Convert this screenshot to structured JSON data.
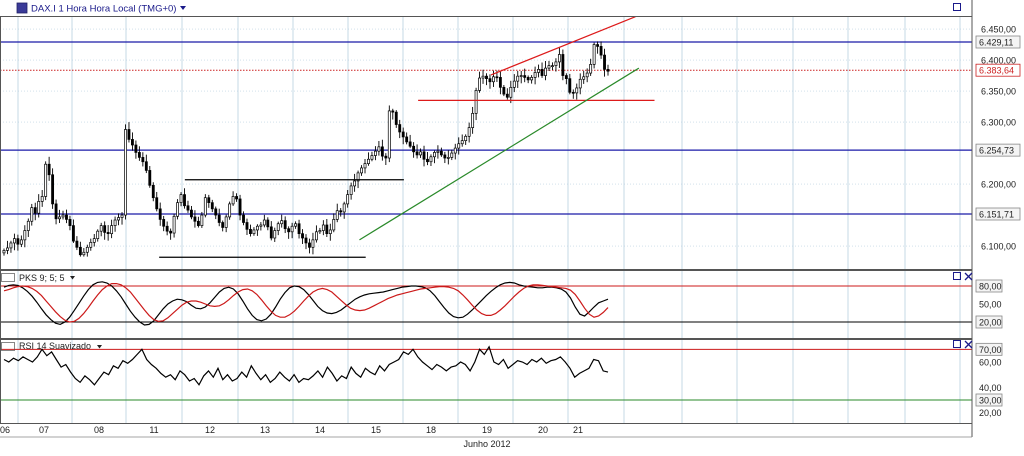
{
  "header": {
    "title": "DAX.I 1 Hora Hora Local (TMG+0)",
    "dropdown_icon": "triangle-down-icon",
    "window_icon": "square-icon"
  },
  "colors": {
    "grid": "#b8cfe0",
    "price_line": "#1a1aa8",
    "last_price": "#cc2222",
    "trend_red": "#dd1a1a",
    "trend_green": "#2a8a2a",
    "black": "#000000",
    "osc_signal": "#cc1a1a"
  },
  "chart_data": [
    {
      "type": "candlestick",
      "title": "DAX.I 1 Hora Hora Local (TMG+0)",
      "y_ticks": [
        "6.450,00",
        "6.400,00",
        "6.350,00",
        "6.300,00",
        "6.200,00",
        "6.150,00",
        "6.100,00"
      ],
      "ylim": [
        6075,
        6465
      ],
      "x_ticks": [
        "06",
        "07",
        "08",
        "11",
        "12",
        "13",
        "14",
        "15",
        "18",
        "19",
        "20",
        "21"
      ],
      "xlabel": "Junho 2012",
      "price_labels": [
        {
          "label": "6.429,11",
          "value": 6429.11,
          "style": "level"
        },
        {
          "label": "6.383,64",
          "value": 6383.64,
          "style": "last"
        },
        {
          "label": "6.254,73",
          "value": 6254.73,
          "style": "level"
        },
        {
          "label": "6.151,71",
          "value": 6151.71,
          "style": "level"
        }
      ],
      "close": [
        6093,
        6097,
        6105,
        6112,
        6103,
        6110,
        6125,
        6140,
        6162,
        6153,
        6172,
        6180,
        6232,
        6215,
        6168,
        6144,
        6147,
        6150,
        6143,
        6133,
        6108,
        6098,
        6086,
        6090,
        6098,
        6106,
        6112,
        6124,
        6133,
        6122,
        6120,
        6133,
        6142,
        6146,
        6150,
        6288,
        6272,
        6263,
        6251,
        6243,
        6236,
        6222,
        6198,
        6178,
        6160,
        6143,
        6132,
        6124,
        6121,
        6148,
        6170,
        6183,
        6165,
        6158,
        6147,
        6140,
        6133,
        6150,
        6178,
        6170,
        6160,
        6150,
        6138,
        6130,
        6147,
        6168,
        6180,
        6176,
        6150,
        6138,
        6127,
        6120,
        6126,
        6132,
        6134,
        6142,
        6131,
        6113,
        6125,
        6136,
        6141,
        6128,
        6123,
        6132,
        6136,
        6120,
        6113,
        6105,
        6098,
        6110,
        6123,
        6125,
        6134,
        6120,
        6126,
        6143,
        6157,
        6155,
        6168,
        6183,
        6197,
        6205,
        6218,
        6226,
        6233,
        6240,
        6246,
        6253,
        6260,
        6245,
        6242,
        6318,
        6316,
        6296,
        6284,
        6276,
        6268,
        6261,
        6252,
        6247,
        6252,
        6240,
        6236,
        6244,
        6251,
        6253,
        6247,
        6242,
        6243,
        6250,
        6258,
        6265,
        6270,
        6277,
        6291,
        6314,
        6351,
        6371,
        6374,
        6370,
        6365,
        6373,
        6372,
        6356,
        6345,
        6340,
        6356,
        6366,
        6374,
        6375,
        6372,
        6368,
        6372,
        6380,
        6385,
        6375,
        6387,
        6391,
        6391,
        6397,
        6409,
        6375,
        6370,
        6348,
        6347,
        6355,
        6369,
        6373,
        6379,
        6393,
        6425,
        6422,
        6408,
        6385,
        6382
      ],
      "high": 6430,
      "low": 6083,
      "horizontal_levels": [
        6429.11,
        6254.73,
        6151.71
      ],
      "last_price": 6383.64,
      "trendlines": [
        {
          "color": "red",
          "x": [
            140.3,
            181.9
          ],
          "y": [
            6376,
            6470
          ]
        },
        {
          "color": "red",
          "x": [
            119.3,
            187.4
          ],
          "y": [
            6335,
            6335
          ]
        },
        {
          "color": "green",
          "x": [
            102.4,
            182.9
          ],
          "y": [
            6110,
            6387
          ]
        },
        {
          "color": "black",
          "x": [
            52.1,
            115.2
          ],
          "y": [
            6207,
            6207
          ]
        },
        {
          "color": "black",
          "x": [
            44.7,
            104.2
          ],
          "y": [
            6082,
            6082
          ]
        }
      ]
    },
    {
      "type": "line",
      "title": "PKS 9; 5; 5",
      "y_ticks": [
        "80,00",
        "50,00",
        "20,00"
      ],
      "ylim": [
        0,
        100
      ],
      "horizontal_levels": [
        80,
        20
      ],
      "series": [
        {
          "color": "black",
          "values": [
            78,
            81,
            82,
            81,
            77,
            71,
            63,
            53,
            42,
            32,
            24,
            18,
            16,
            20,
            28,
            39,
            51,
            63,
            74,
            82,
            86,
            87,
            85,
            80,
            72,
            62,
            50,
            38,
            28,
            20,
            15,
            16,
            22,
            32,
            42,
            50,
            55,
            58,
            57,
            54,
            48,
            43,
            42,
            45,
            52,
            61,
            70,
            76,
            78,
            75,
            67,
            55,
            42,
            31,
            24,
            22,
            25,
            33,
            45,
            58,
            69,
            77,
            80,
            79,
            74,
            66,
            56,
            46,
            39,
            35,
            34,
            36,
            40,
            46,
            52,
            58,
            62,
            65,
            67,
            68,
            69,
            70,
            72,
            74,
            76,
            78,
            79,
            80,
            80,
            79,
            77,
            72,
            64,
            54,
            44,
            35,
            29,
            27,
            28,
            33,
            40,
            48,
            56,
            64,
            71,
            77,
            82,
            85,
            86,
            85,
            82,
            80,
            79,
            78,
            77,
            77,
            78,
            78,
            77,
            75,
            70,
            60,
            45,
            33,
            30,
            37,
            45,
            52,
            55,
            58
          ]
        },
        {
          "color": "red",
          "values": [
            72,
            74,
            77,
            79,
            80,
            79,
            76,
            71,
            64,
            55,
            46,
            37,
            29,
            23,
            20,
            21,
            26,
            34,
            44,
            55,
            65,
            74,
            80,
            84,
            84,
            82,
            77,
            70,
            60,
            50,
            40,
            31,
            24,
            21,
            22,
            27,
            34,
            41,
            48,
            53,
            55,
            55,
            53,
            50,
            47,
            46,
            47,
            51,
            57,
            64,
            70,
            74,
            75,
            72,
            66,
            57,
            47,
            38,
            31,
            28,
            28,
            32,
            38,
            46,
            55,
            63,
            70,
            74,
            76,
            74,
            70,
            63,
            56,
            49,
            43,
            40,
            39,
            40,
            43,
            47,
            51,
            55,
            59,
            62,
            65,
            67,
            69,
            71,
            73,
            75,
            76,
            77,
            78,
            79,
            79,
            78,
            76,
            72,
            65,
            57,
            48,
            40,
            34,
            31,
            31,
            34,
            40,
            47,
            55,
            63,
            70,
            76,
            80,
            82,
            82,
            81,
            80,
            79,
            78,
            77,
            76,
            73,
            66,
            55,
            43,
            33,
            28,
            30,
            36,
            44
          ]
        }
      ]
    },
    {
      "type": "line",
      "title": "RSI 14 Suavizado",
      "y_ticks": [
        "70,00",
        "60,00",
        "40,00",
        "30,00",
        "20,00"
      ],
      "ylim": [
        15,
        75
      ],
      "horizontal_levels": [
        70,
        30
      ],
      "series": [
        {
          "color": "black",
          "values": [
            62,
            60,
            63,
            61,
            64,
            62,
            60,
            64,
            70,
            65,
            68,
            62,
            56,
            58,
            52,
            47,
            44,
            49,
            46,
            42,
            47,
            52,
            50,
            57,
            55,
            61,
            59,
            62,
            66,
            70,
            62,
            58,
            55,
            51,
            48,
            50,
            46,
            53,
            50,
            45,
            47,
            42,
            49,
            53,
            48,
            55,
            46,
            50,
            45,
            47,
            52,
            48,
            57,
            51,
            46,
            50,
            44,
            47,
            52,
            48,
            45,
            50,
            44,
            47,
            46,
            49,
            53,
            48,
            56,
            51,
            45,
            49,
            47,
            56,
            51,
            48,
            55,
            52,
            50,
            57,
            53,
            58,
            60,
            62,
            68,
            66,
            70,
            64,
            60,
            57,
            54,
            58,
            56,
            53,
            56,
            57,
            60,
            58,
            53,
            60,
            70,
            66,
            72,
            60,
            58,
            62,
            55,
            58,
            61,
            60,
            58,
            62,
            60,
            63,
            59,
            61,
            62,
            64,
            60,
            55,
            48,
            51,
            53,
            55,
            62,
            61,
            53,
            52
          ]
        }
      ]
    }
  ]
}
